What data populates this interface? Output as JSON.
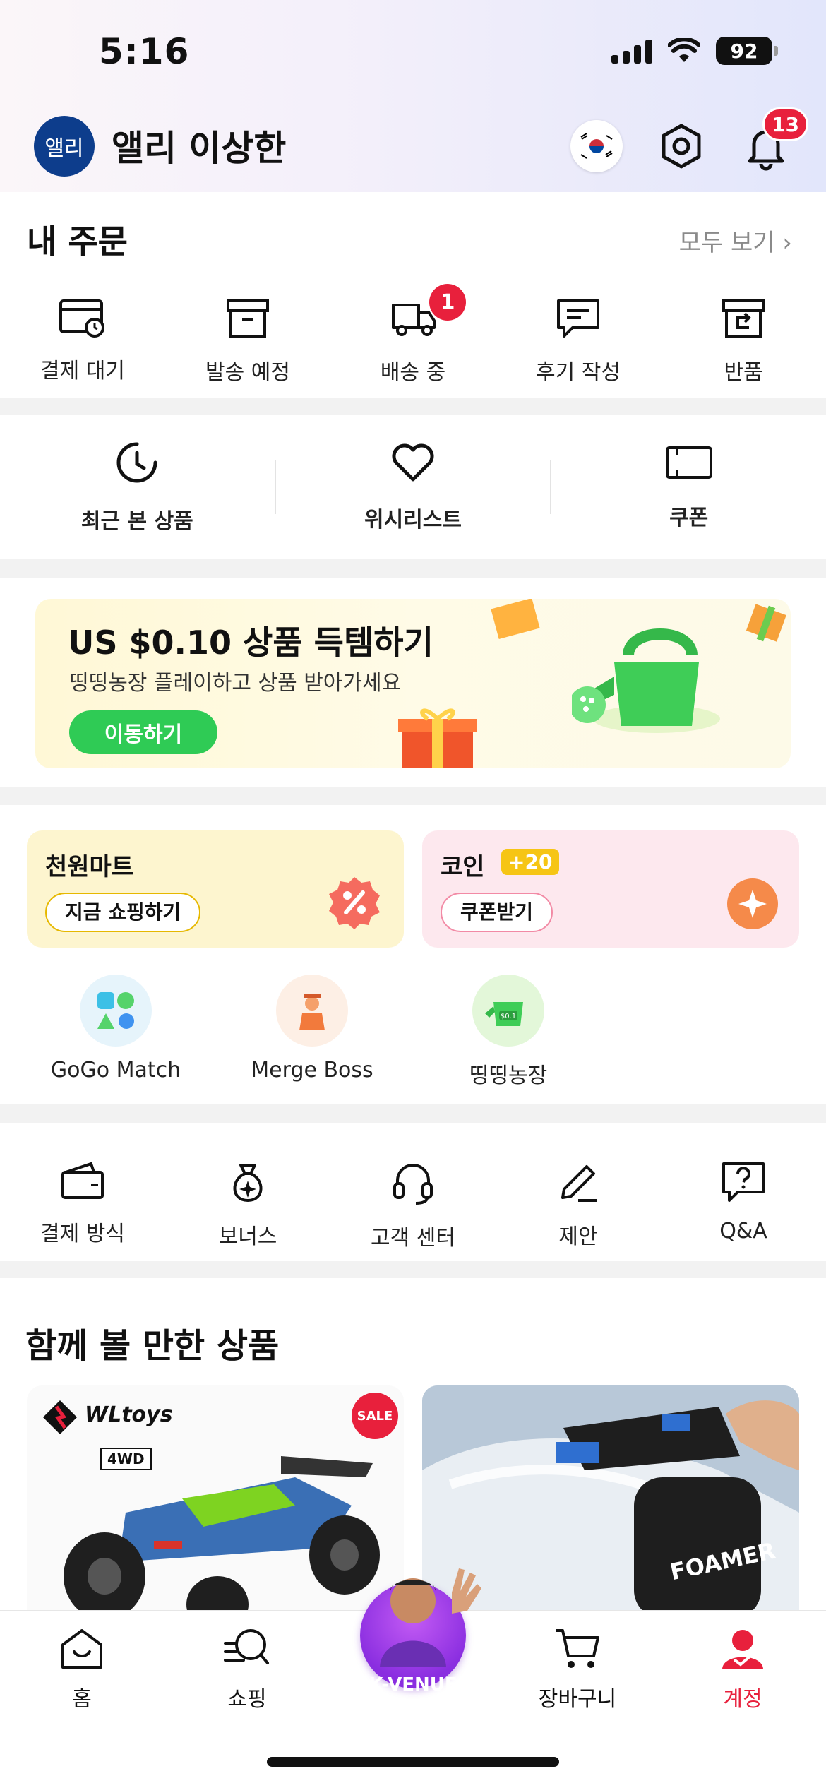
{
  "status_bar": {
    "time": "5:16",
    "battery": "92"
  },
  "header": {
    "avatar_text": "앨리",
    "username": "앨리 이상한",
    "notification_count": "13"
  },
  "orders": {
    "title": "내 주문",
    "see_all": "모두 보기 ›",
    "items": [
      {
        "label": "결제 대기",
        "icon": "payment-pending-icon"
      },
      {
        "label": "발송 예정",
        "icon": "box-icon"
      },
      {
        "label": "배송 중",
        "icon": "truck-icon",
        "badge": "1"
      },
      {
        "label": "후기 작성",
        "icon": "review-icon"
      },
      {
        "label": "반품",
        "icon": "return-icon"
      }
    ]
  },
  "shortcuts": {
    "items": [
      {
        "label": "최근 본 상품",
        "icon": "clock-icon"
      },
      {
        "label": "위시리스트",
        "icon": "heart-icon"
      },
      {
        "label": "쿠폰",
        "icon": "coupon-icon"
      }
    ]
  },
  "banner": {
    "title": "US $0.10 상품 득템하기",
    "subtitle": "띵띵농장 플레이하고 상품 받아가세요",
    "button": "이동하기"
  },
  "promos": {
    "mart": {
      "title": "천원마트",
      "button": "지금 쇼핑하기"
    },
    "coin": {
      "title": "코인",
      "plus": "+20",
      "button": "쿠폰받기"
    }
  },
  "games": [
    {
      "label": "GoGo Match"
    },
    {
      "label": "Merge Boss"
    },
    {
      "label": "띵띵농장"
    }
  ],
  "services": {
    "items": [
      {
        "label": "결제 방식",
        "icon": "wallet-icon"
      },
      {
        "label": "보너스",
        "icon": "bonus-bag-icon"
      },
      {
        "label": "고객 센터",
        "icon": "headset-icon"
      },
      {
        "label": "제안",
        "icon": "pencil-icon"
      },
      {
        "label": "Q&A",
        "icon": "question-icon"
      }
    ]
  },
  "recommend": {
    "title": "함께 볼 만한 상품",
    "product1_brand": "WLtoys",
    "product1_tag": "SALE",
    "product1_sub": "4WD",
    "product2_brand": "FOAMER"
  },
  "tabbar": {
    "items": [
      {
        "label": "홈"
      },
      {
        "label": "쇼핑"
      },
      {
        "label": "K-VENUE"
      },
      {
        "label": "장바구니"
      },
      {
        "label": "계정"
      }
    ],
    "active_color": "#e8203c"
  }
}
